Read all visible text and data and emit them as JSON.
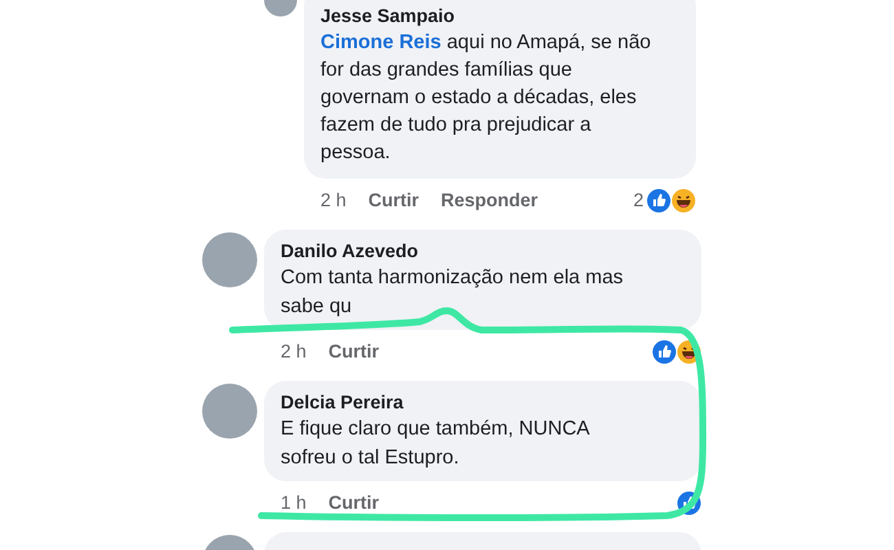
{
  "comments": [
    {
      "kind": "reply",
      "name": "Jesse Sampaio",
      "mention": "Cimone Reis",
      "text": "aqui no Amapá, se não for das grandes famílias que governam o estado a décadas, eles fazem de tudo pra prejudicar a pessoa.",
      "time": "2 h",
      "like_label": "Curtir",
      "reply_label": "Responder",
      "reaction_count": "2",
      "like_reaction": true,
      "haha_reaction": true
    },
    {
      "kind": "comment",
      "name": "Danilo Azevedo",
      "text": "Com tanta harmonização nem ela mas sabe qu",
      "time": "2 h",
      "like_label": "Curtir",
      "like_reaction": true,
      "haha_reaction": true
    },
    {
      "kind": "comment",
      "name": "Delcia Pereira",
      "text": "E fique claro que também, NUNCA sofreu o tal Estupro.",
      "time": "1 h",
      "like_label": "Curtir",
      "like_reaction": true
    },
    {
      "kind": "cut"
    }
  ]
}
